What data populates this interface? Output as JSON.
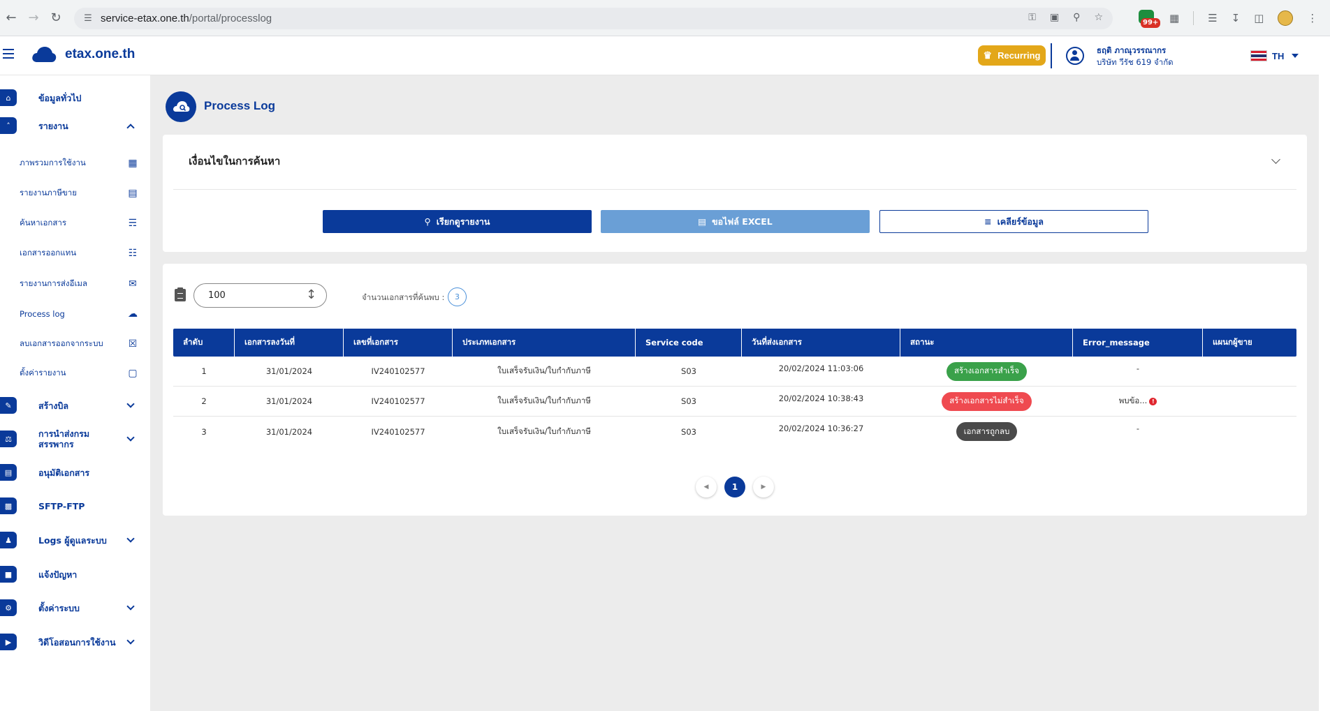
{
  "browser": {
    "url_host": "service-etax.one.th",
    "url_path": "/portal/processlog",
    "ext_badge": "99+"
  },
  "header": {
    "logo_text": "etax.one.th",
    "recurring_label": "Recurring",
    "user_name": "ธฤติ ภาณุวรรณากร",
    "user_company": "บริษัท วีรัช 619 จำกัด",
    "lang": "TH"
  },
  "sidebar": {
    "items": [
      {
        "label": "ข้อมูลทั่วไป",
        "icon": "home-icon"
      },
      {
        "label": "รายงาน",
        "icon": "chevron-up-icon"
      },
      {
        "label": "สร้างบิล",
        "icon": "bill-icon"
      },
      {
        "label": "การนำส่งกรม",
        "label2": "สรรพากร",
        "icon": "bank-icon"
      },
      {
        "label": "อนุมัติเอกสาร",
        "icon": "document-icon"
      },
      {
        "label": "SFTP-FTP",
        "icon": "folder-icon"
      },
      {
        "label": "Logs ผู้ดูแลระบบ",
        "icon": "admin-icon"
      },
      {
        "label": "แจ้งปัญหา",
        "icon": "chat-icon"
      },
      {
        "label": "ตั้งค่าระบบ",
        "icon": "gear-icon"
      },
      {
        "label": "วิดีโอสอนการใช้งาน",
        "icon": "video-icon"
      }
    ],
    "sub_items": [
      {
        "label": "ภาพรวมการใช้งาน",
        "icon": "chart-icon"
      },
      {
        "label": "รายงานภาษีขาย",
        "icon": "list-icon"
      },
      {
        "label": "ค้นหาเอกสาร",
        "icon": "search-doc-icon"
      },
      {
        "label": "เอกสารออกแทน",
        "icon": "clipboard-icon"
      },
      {
        "label": "รายงานการส่งอีเมล",
        "icon": "mail-icon"
      },
      {
        "label": "Process log",
        "icon": "cloud-search-icon"
      },
      {
        "label": "ลบเอกสารออกจากระบบ",
        "icon": "trash-icon"
      },
      {
        "label": "ตั้งค่ารายงาน",
        "icon": "file-icon"
      }
    ]
  },
  "page": {
    "title": "Process Log"
  },
  "search": {
    "heading": "เงื่อนไขในการค้นหา",
    "report_button": "เรียกดูรายงาน",
    "excel_button": "ขอไฟล์ EXCEL",
    "clear_button": "เคลียร์ข้อมูล"
  },
  "table": {
    "page_size": "100",
    "found_label": "จำนวนเอกสารที่ค้นพบ :",
    "found_count": "3",
    "columns": [
      "ลำดับ",
      "เอกสารลงวันที่",
      "เลขที่เอกสาร",
      "ประเภทเอกสาร",
      "Service code",
      "วันที่ส่งเอกสาร",
      "สถานะ",
      "Error_message",
      "แผนกผู้ขาย"
    ],
    "rows": [
      {
        "no": "1",
        "doc_date": "31/01/2024",
        "doc_no": "IV240102577",
        "doc_type": "ใบเสร็จรับเงิน/ใบกำกับภาษี",
        "service_code": "S03",
        "sent_date": "20/02/2024 11:03:06",
        "status": "สร้างเอกสารสำเร็จ",
        "status_color": "#3aa14a",
        "error": "-",
        "dept": ""
      },
      {
        "no": "2",
        "doc_date": "31/01/2024",
        "doc_no": "IV240102577",
        "doc_type": "ใบเสร็จรับเงิน/ใบกำกับภาษี",
        "service_code": "S03",
        "sent_date": "20/02/2024 10:38:43",
        "status": "สร้างเอกสารไม่สำเร็จ",
        "status_color": "#ef4a50",
        "error": "พบข้อ...",
        "dept": ""
      },
      {
        "no": "3",
        "doc_date": "31/01/2024",
        "doc_no": "IV240102577",
        "doc_type": "ใบเสร็จรับเงิน/ใบกำกับภาษี",
        "service_code": "S03",
        "sent_date": "20/02/2024 10:36:27",
        "status": "เอกสารถูกลบ",
        "status_color": "#4a4a4a",
        "error": "-",
        "dept": ""
      }
    ]
  },
  "pagination": {
    "current": "1"
  },
  "colors": {
    "primary": "#0a3a9a",
    "accent_gold": "#e3a719",
    "excel_btn": "#6a9fd6"
  }
}
